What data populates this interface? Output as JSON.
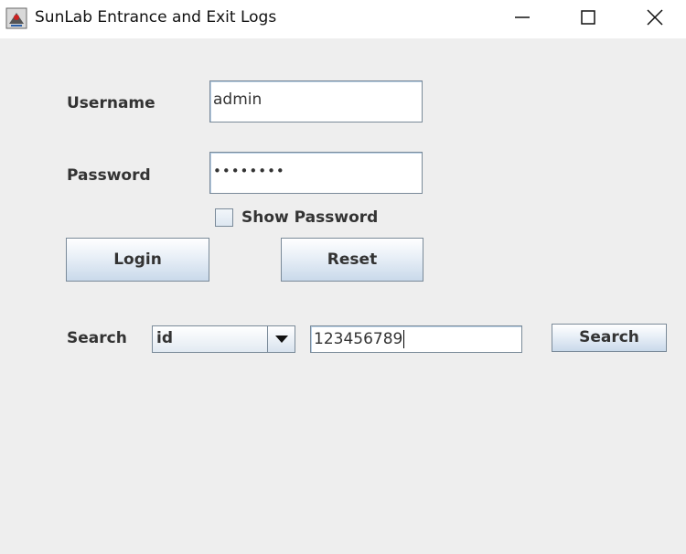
{
  "window": {
    "title": "SunLab Entrance and Exit Logs"
  },
  "login": {
    "username_label": "Username",
    "username_value": "admin",
    "password_label": "Password",
    "password_masked": "••••••••",
    "show_password_label": "Show Password",
    "show_password_checked": false,
    "login_button": "Login",
    "reset_button": "Reset"
  },
  "search": {
    "label": "Search",
    "field_selected": "id",
    "query_value": "123456789",
    "search_button": "Search"
  },
  "icons": {
    "app": "java-app-icon",
    "minimize": "minimize-icon",
    "maximize": "maximize-icon",
    "close": "close-icon",
    "dropdown": "triangle-down-icon"
  }
}
